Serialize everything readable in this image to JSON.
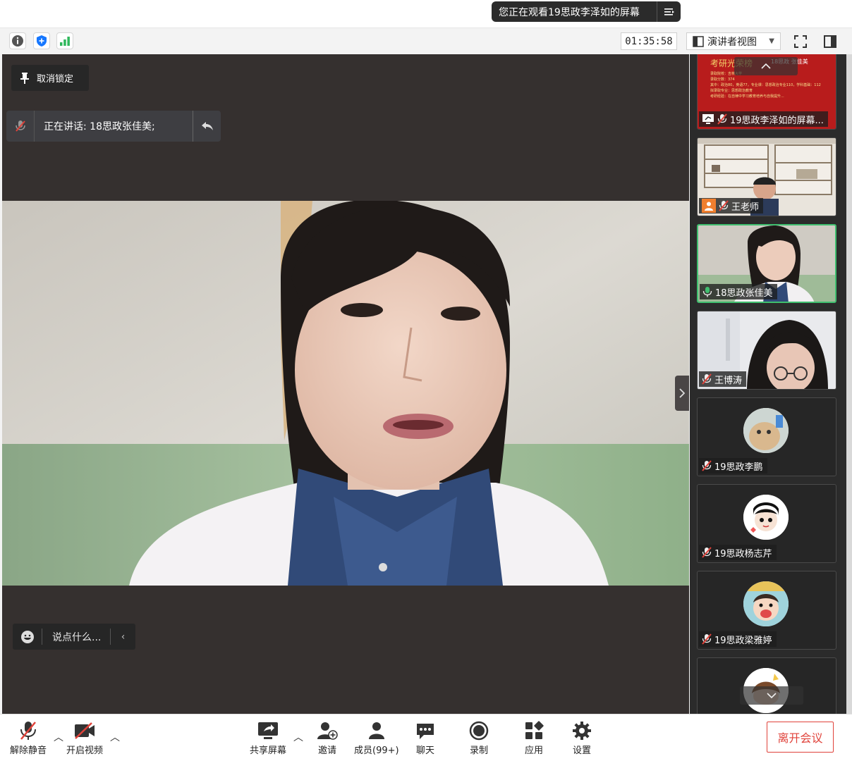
{
  "share_banner": {
    "text": "您正在观看19思政李泽如的屏幕"
  },
  "status_bar": {
    "timer": "01:35:58",
    "view_mode": "演讲者视图"
  },
  "stage": {
    "unlock_label": "取消锁定",
    "speaking_label": "正在讲话: 18思政张佳美;",
    "chat_placeholder": "说点什么..."
  },
  "thumbnails": [
    {
      "name": "19思政李泽如的屏幕...",
      "type": "screen-share",
      "slide": {
        "title": "考研光荣榜",
        "subtitle": "18思政  张佳美",
        "lines": [
          "录取院校：吉林大学",
          "录取分数：374",
          "其中：政治80，英语77，专业课：思想政治专业110，学科基础：112",
          "拟录取专业：思想政治教育",
          "考研经验：在自律中学习教育培养与自我提升..."
        ]
      }
    },
    {
      "name": "王老师",
      "type": "camera",
      "muted": true
    },
    {
      "name": "18思政张佳美",
      "type": "camera",
      "muted": false,
      "active": true
    },
    {
      "name": "王博涛",
      "type": "camera",
      "muted": true
    },
    {
      "name": "19思政李鹏",
      "type": "avatar",
      "muted": true
    },
    {
      "name": "19思政杨志芹",
      "type": "avatar",
      "muted": true
    },
    {
      "name": "19思政梁雅婷",
      "type": "avatar",
      "muted": true
    },
    {
      "name": "",
      "type": "avatar",
      "muted": true
    }
  ],
  "controls": {
    "unmute": "解除静音",
    "start_video": "开启视频",
    "share_screen": "共享屏幕",
    "invite": "邀请",
    "members": "成员(99+)",
    "chat": "聊天",
    "record": "录制",
    "apps": "应用",
    "settings": "设置",
    "leave": "离开会议"
  },
  "colors": {
    "stage_bg": "#35302f",
    "active_border": "#3fbf6f",
    "leave_red": "#e0423a",
    "muted_red": "#e0423a",
    "slide_red": "#b81c1c",
    "mic_green": "#3fbf6f"
  }
}
